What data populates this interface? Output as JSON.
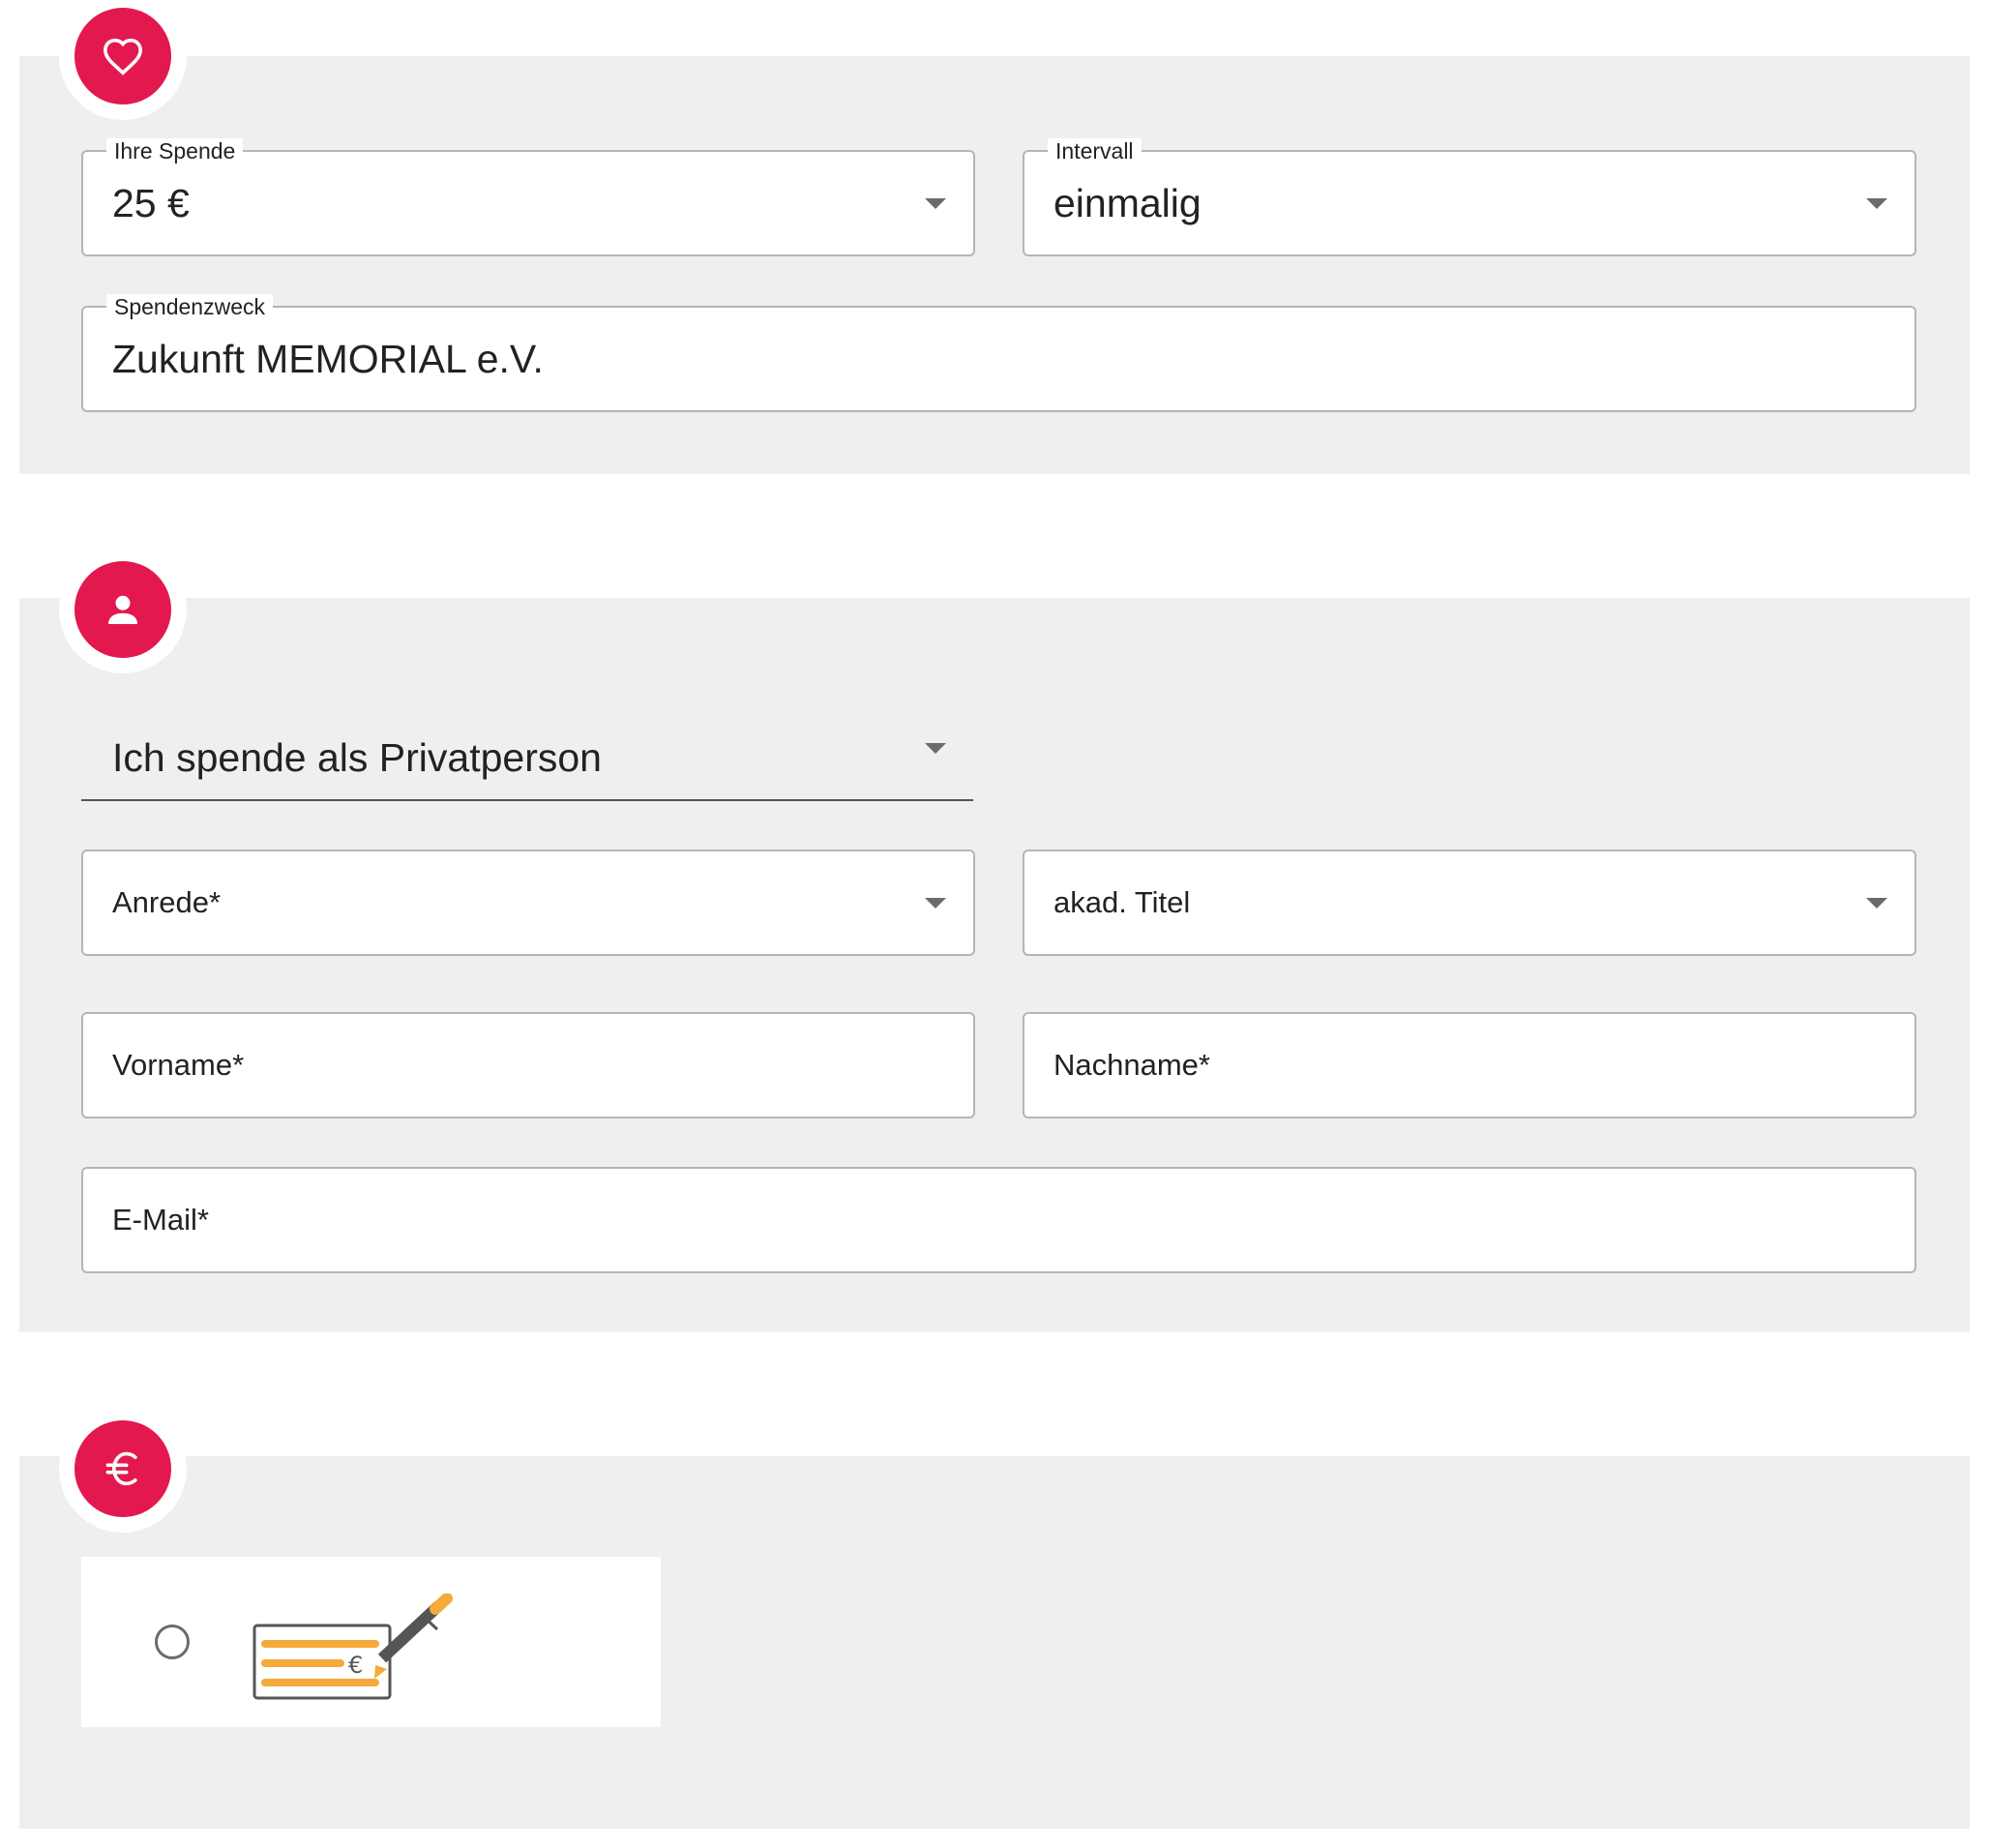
{
  "donation": {
    "amount_label": "Ihre Spende",
    "amount_value": "25 €",
    "interval_label": "Intervall",
    "interval_value": "einmalig",
    "purpose_label": "Spendenzweck",
    "purpose_value": "Zukunft MEMORIAL e.V."
  },
  "personal": {
    "donor_type_value": "Ich spende als Privatperson",
    "salutation_label": "Anrede*",
    "title_label": "akad. Titel",
    "firstname_label": "Vorname*",
    "lastname_label": "Nachname*",
    "email_label": "E-Mail*"
  },
  "payment": {
    "option_icon": "cheque-with-pen",
    "check_currency": "€"
  },
  "icons": {
    "section1": "heart-icon",
    "section2": "person-icon",
    "section3": "euro-icon"
  },
  "colors": {
    "accent": "#e3184f",
    "section_bg": "#efefef",
    "cheque_lines": "#f5aa3a"
  }
}
